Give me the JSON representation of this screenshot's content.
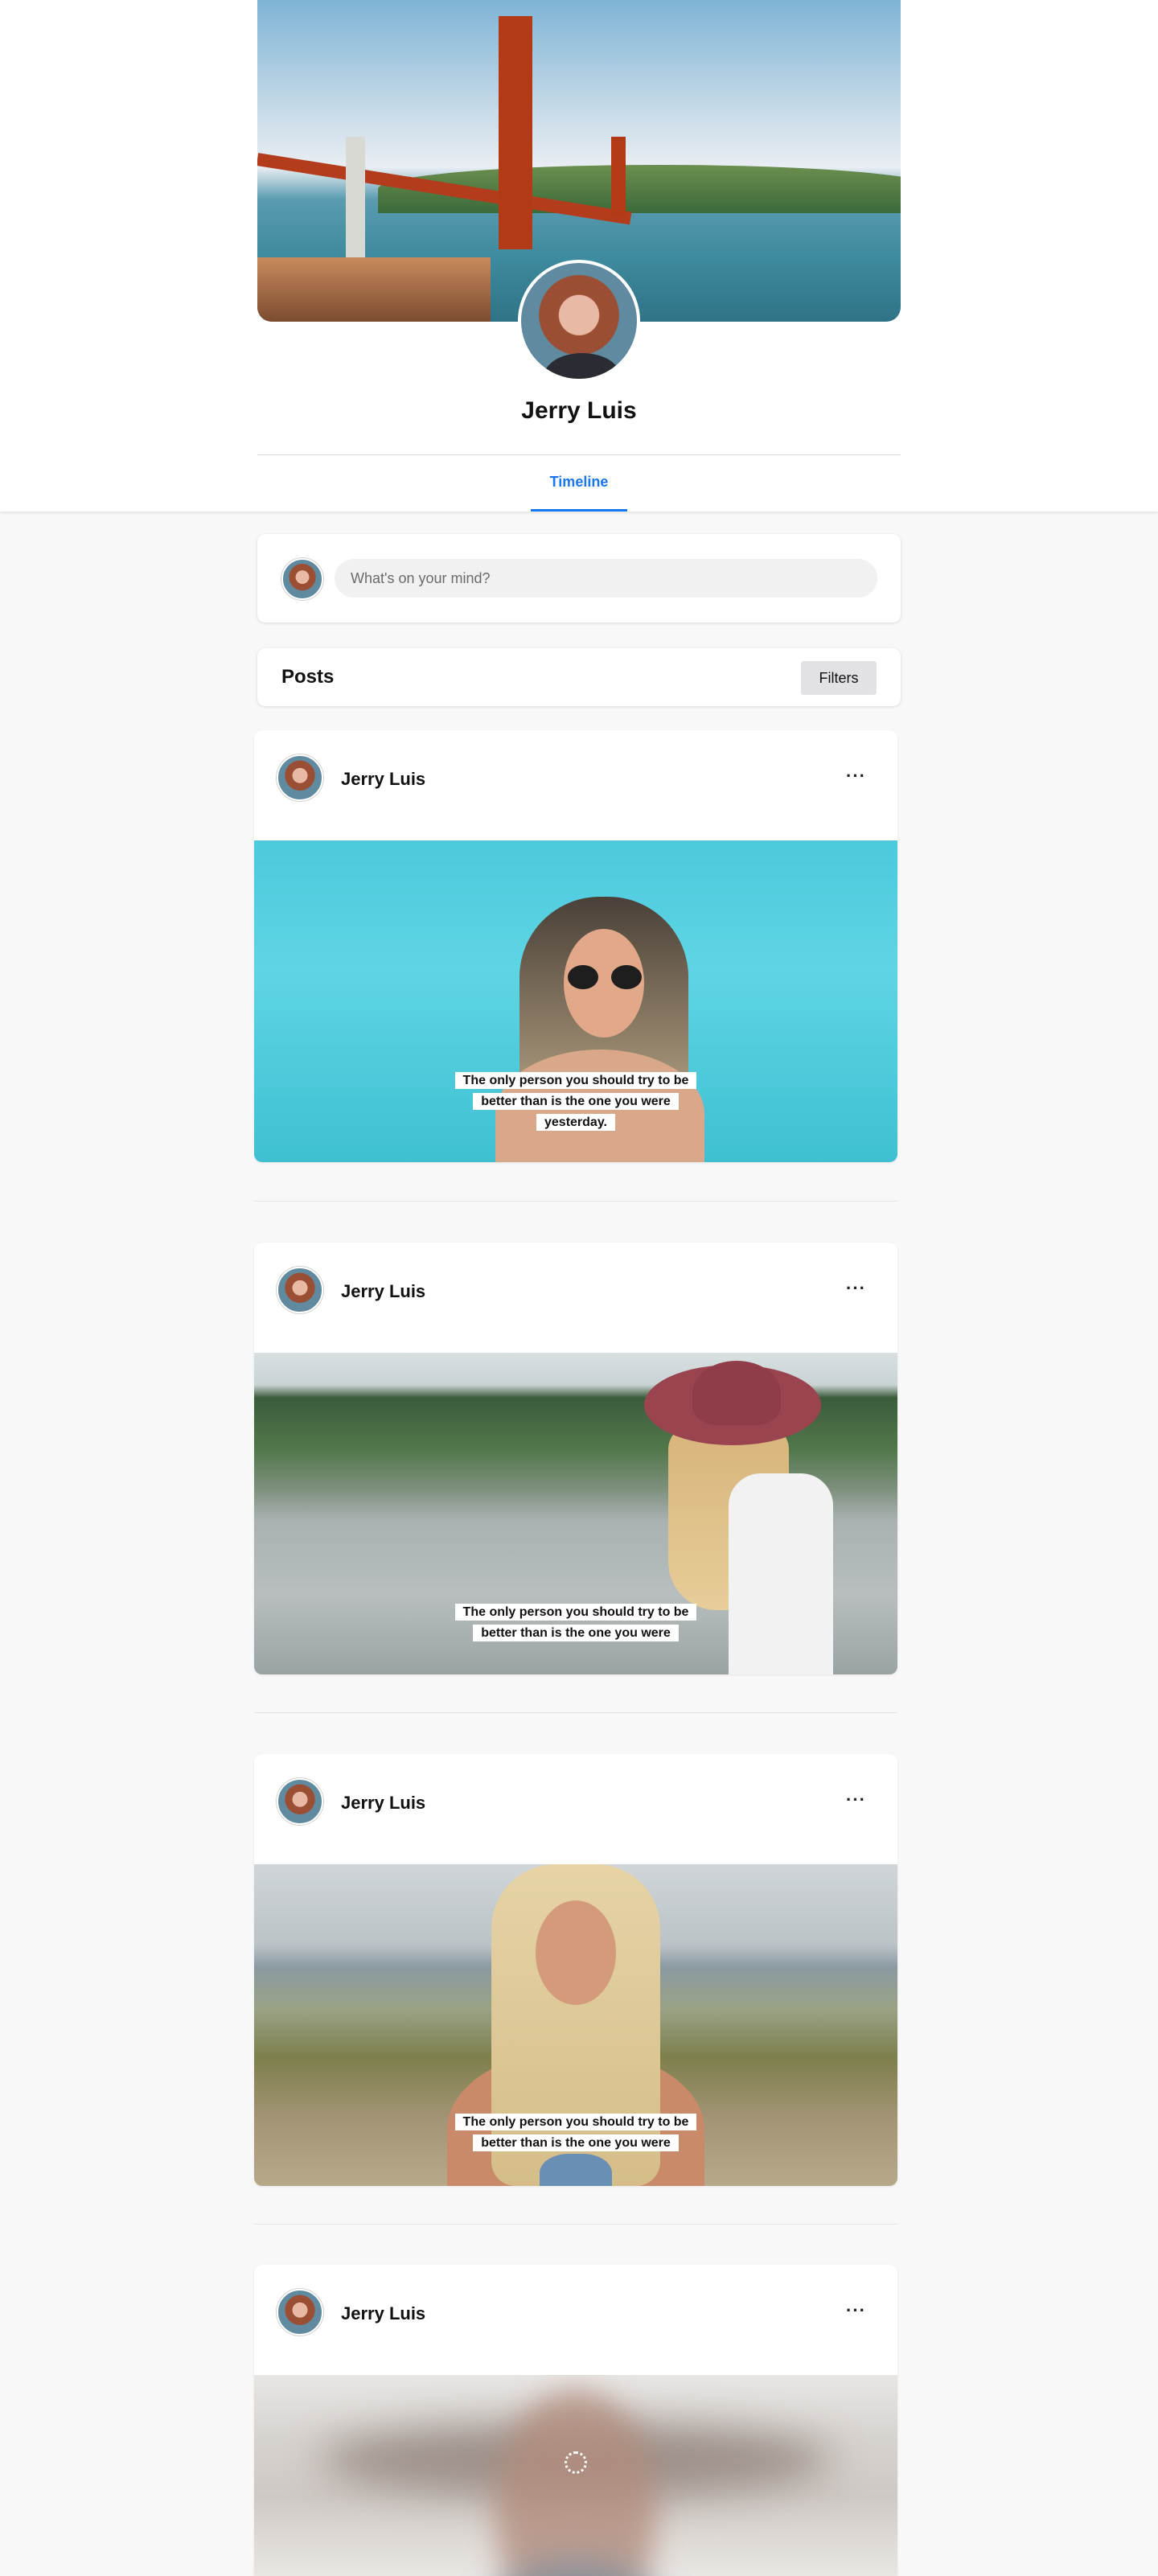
{
  "profile": {
    "name": "Jerry Luis",
    "tabs": [
      {
        "label": "Timeline",
        "active": true
      }
    ]
  },
  "composer": {
    "placeholder": "What's on your mind?"
  },
  "posts_section": {
    "title": "Posts",
    "filters_label": "Filters"
  },
  "posts": [
    {
      "author": "Jerry Luis",
      "more": "···",
      "caption": "The only person you should try to be better than is the one you were yesterday."
    },
    {
      "author": "Jerry Luis",
      "more": "···",
      "caption": "The only person you should try to be better than is the one you were"
    },
    {
      "author": "Jerry Luis",
      "more": "···",
      "caption": "The only person you should try to be better than is the one you were"
    },
    {
      "author": "Jerry Luis",
      "more": "···",
      "loading": true
    }
  ],
  "colors": {
    "accent": "#1877f2",
    "page_bg": "#f8f8f8"
  }
}
